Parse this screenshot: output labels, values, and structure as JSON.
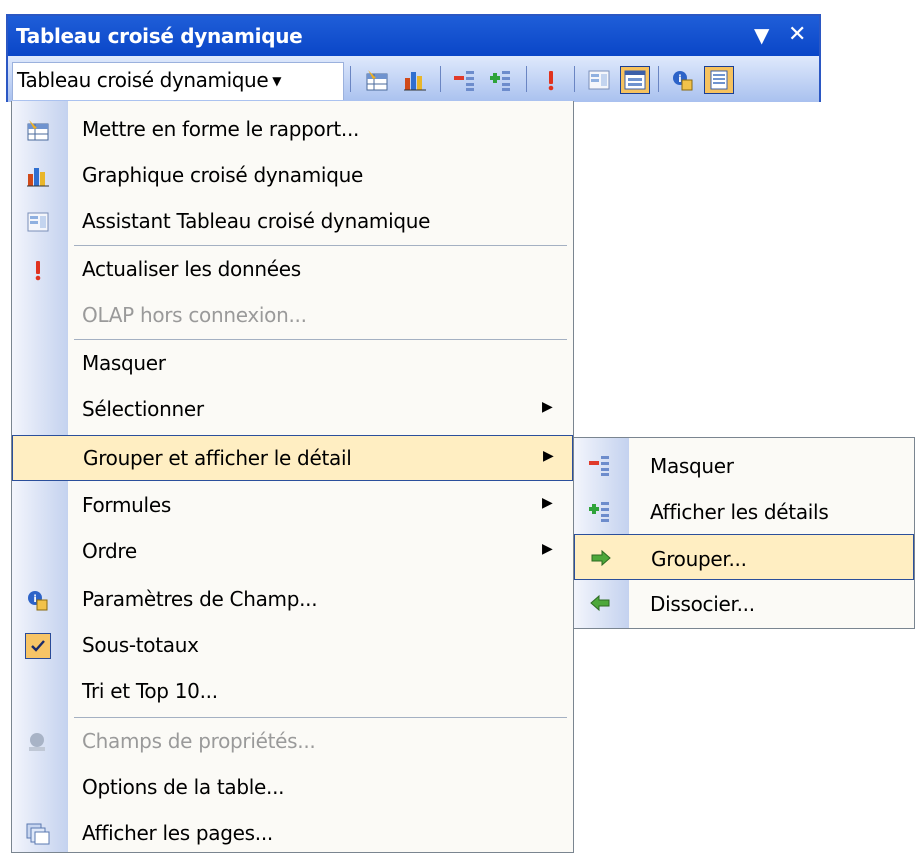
{
  "toolbar": {
    "title": "Tableau croisé dynamique",
    "dropdown_icon": "triangle-down-icon",
    "close_icon": "close-icon",
    "menu_button_label": "Tableau croisé dynamique",
    "icons": [
      "format-report-icon",
      "pivot-chart-icon",
      "hide-detail-icon",
      "show-detail-icon",
      "refresh-icon",
      "field-settings-icon",
      "show-field-list-icon",
      "field-params-icon",
      "table-options-icon"
    ]
  },
  "menu": {
    "items": [
      {
        "label": "Mettre en forme le rapport...",
        "icon": "format-report-icon",
        "disabled": false
      },
      {
        "label": "Graphique croisé dynamique",
        "icon": "pivot-chart-icon",
        "disabled": false
      },
      {
        "label": "Assistant Tableau croisé dynamique",
        "icon": "wizard-icon",
        "disabled": false
      },
      {
        "label": "Actualiser les données",
        "icon": "refresh-icon",
        "disabled": false
      },
      {
        "label": "OLAP hors connexion...",
        "icon": "",
        "disabled": true
      },
      {
        "label": "Masquer",
        "icon": "",
        "disabled": false
      },
      {
        "label": "Sélectionner",
        "icon": "",
        "disabled": false,
        "submenu": true
      },
      {
        "label": "Grouper et afficher le détail",
        "icon": "",
        "disabled": false,
        "submenu": true,
        "highlighted": true
      },
      {
        "label": "Formules",
        "icon": "",
        "disabled": false,
        "submenu": true
      },
      {
        "label": "Ordre",
        "icon": "",
        "disabled": false,
        "submenu": true
      },
      {
        "label": "Paramètres de Champ...",
        "icon": "field-settings-icon",
        "disabled": false
      },
      {
        "label": "Sous-totaux",
        "icon": "check-icon",
        "disabled": false,
        "checked": true
      },
      {
        "label": "Tri et Top 10...",
        "icon": "",
        "disabled": false
      },
      {
        "label": "Champs de propriétés...",
        "icon": "property-fields-icon",
        "disabled": true
      },
      {
        "label": "Options de la table...",
        "icon": "",
        "disabled": false
      },
      {
        "label": "Afficher les pages...",
        "icon": "show-pages-icon",
        "disabled": false
      }
    ]
  },
  "submenu": {
    "items": [
      {
        "label": "Masquer",
        "icon": "hide-detail-icon"
      },
      {
        "label": "Afficher les détails",
        "icon": "show-detail-icon"
      },
      {
        "label": "Grouper...",
        "icon": "group-arrow-icon",
        "highlighted": true
      },
      {
        "label": "Dissocier...",
        "icon": "ungroup-arrow-icon"
      }
    ]
  },
  "colors": {
    "title_bar": "#0a46c8",
    "highlight": "#ffeec2",
    "highlight_border": "#2b4f9b",
    "icon_strip": "#c4d2ef"
  }
}
